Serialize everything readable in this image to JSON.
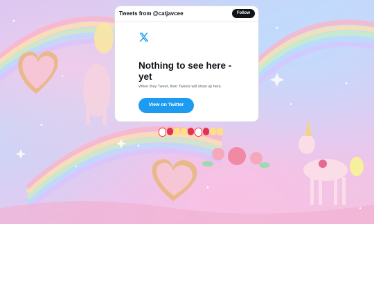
{
  "widget": {
    "header_title": "Tweets from @catjavcee",
    "follow_label": "Follow",
    "empty_title": "Nothing to see here - yet",
    "empty_subtitle": "When they Tweet, their Tweets will show up here.",
    "view_button_label": "View on Twitter",
    "brand_color": "#1d9bf0"
  },
  "icons": {
    "logo": "x-logo-icon"
  }
}
